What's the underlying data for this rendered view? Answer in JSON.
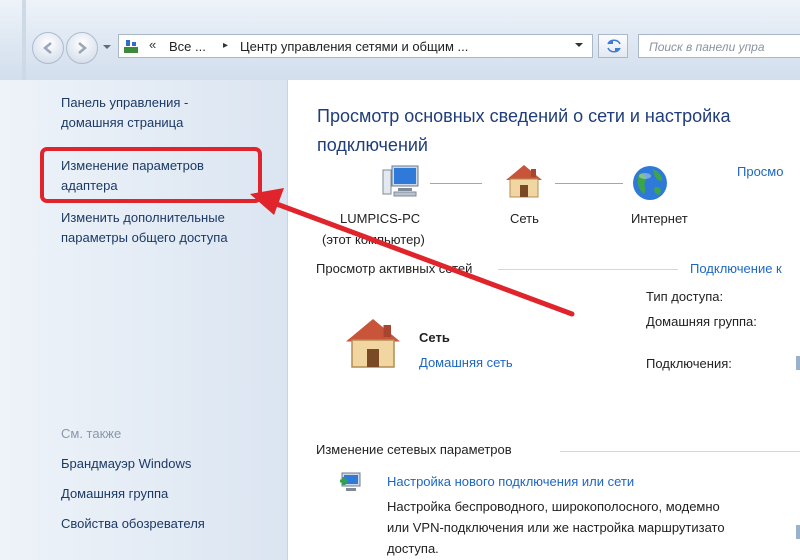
{
  "address_bar": {
    "segments": [
      "Все ...",
      "Центр управления сетями и общим ..."
    ],
    "chevron": "«",
    "separator": "▸"
  },
  "search": {
    "placeholder": "Поиск в панели упра"
  },
  "sidebar": {
    "home_link": [
      "Панель управления -",
      "домашняя страница"
    ],
    "adapter_link": [
      "Изменение параметров",
      "адаптера"
    ],
    "sharing_link": [
      "Изменить дополнительные",
      "параметры общего доступа"
    ],
    "see_also_label": "См. также",
    "see_also_items": [
      "Брандмауэр Windows",
      "Домашняя группа",
      "Свойства обозревателя"
    ]
  },
  "main": {
    "title": "Просмотр основных сведений о сети и настройка подключений",
    "full_map_link": "Просмо",
    "network_map": {
      "computer_label": "LUMPICS-PC",
      "computer_sub": "(этот компьютер)",
      "network_label": "Сеть",
      "internet_label": "Интернет"
    },
    "active_networks": {
      "heading": "Просмотр активных сетей",
      "connect_link": "Подключение к",
      "network_name": "Сеть",
      "network_type": "Домашняя сеть",
      "access_type_label": "Тип доступа:",
      "homegroup_label": "Домашняя группа:",
      "connections_label": "Подключения:"
    },
    "change_settings": {
      "heading": "Изменение сетевых параметров",
      "new_connection_link": "Настройка нового подключения или сети",
      "new_connection_desc": [
        "Настройка беспроводного, широкополосного, модемно",
        "или VPN-подключения или же настройка маршрутизато",
        "доступа."
      ]
    }
  },
  "colors": {
    "annotation": "#e0242b",
    "link": "#1d66c5",
    "heading": "#1f3d7a",
    "sidebar_link": "#1c3a66"
  },
  "icons": [
    "back-icon",
    "forward-icon",
    "control-panel-icon",
    "refresh-icon",
    "computer-icon",
    "house-icon",
    "globe-icon",
    "new-connection-icon"
  ]
}
